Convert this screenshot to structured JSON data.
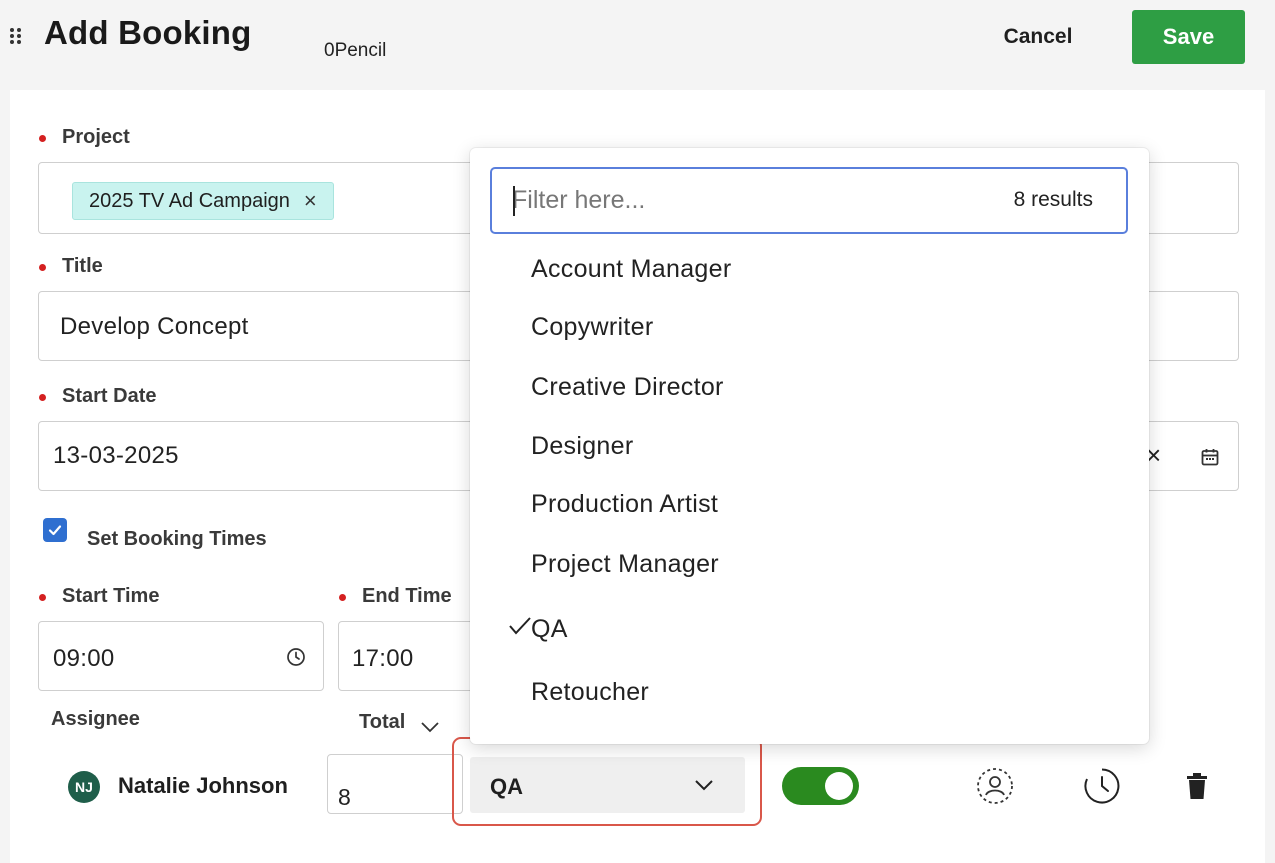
{
  "header": {
    "title": "Add Booking",
    "subtitle": "0Pencil",
    "cancel_label": "Cancel",
    "save_label": "Save",
    "save_color": "#2e9e44"
  },
  "form": {
    "project": {
      "label": "Project",
      "chip": "2025 TV Ad Campaign",
      "chip_remove": "×"
    },
    "title": {
      "label": "Title",
      "value": "Develop Concept"
    },
    "start_date": {
      "label": "Start Date",
      "value": "13-03-2025",
      "clear": "×"
    },
    "booking_times": {
      "label": "Set Booking Times",
      "checked": true
    },
    "start_time": {
      "label": "Start Time",
      "value": "09:00"
    },
    "end_time": {
      "label": "End Time",
      "value": "17:00"
    },
    "assignee_header": "Assignee",
    "total_header": "Total"
  },
  "assignee": {
    "initials": "NJ",
    "name": "Natalie Johnson",
    "hours": "8",
    "role": "QA",
    "enabled": true,
    "avatar_color": "#1f5e4a",
    "toggle_color": "#2a8a1f"
  },
  "dropdown": {
    "placeholder": "Filter here...",
    "results": "8 results",
    "options": [
      {
        "label": "Account Manager",
        "selected": false
      },
      {
        "label": "Copywriter",
        "selected": false
      },
      {
        "label": "Creative Director",
        "selected": false
      },
      {
        "label": "Designer",
        "selected": false
      },
      {
        "label": "Production Artist",
        "selected": false
      },
      {
        "label": "Project Manager",
        "selected": false
      },
      {
        "label": "QA",
        "selected": true
      },
      {
        "label": "Retoucher",
        "selected": false
      }
    ]
  },
  "icons": [
    "drag-handle-icon",
    "close-icon",
    "calendar-icon",
    "clock-icon",
    "chevron-down-icon",
    "check-icon",
    "checkmark-icon",
    "user-circle-icon",
    "history-icon",
    "trash-icon"
  ],
  "colors": {
    "required": "#d42020",
    "accent": "#2f6fd0",
    "focus": "#5a7fdc",
    "highlight": "#d9574a",
    "chip": "#c9f3ef"
  }
}
